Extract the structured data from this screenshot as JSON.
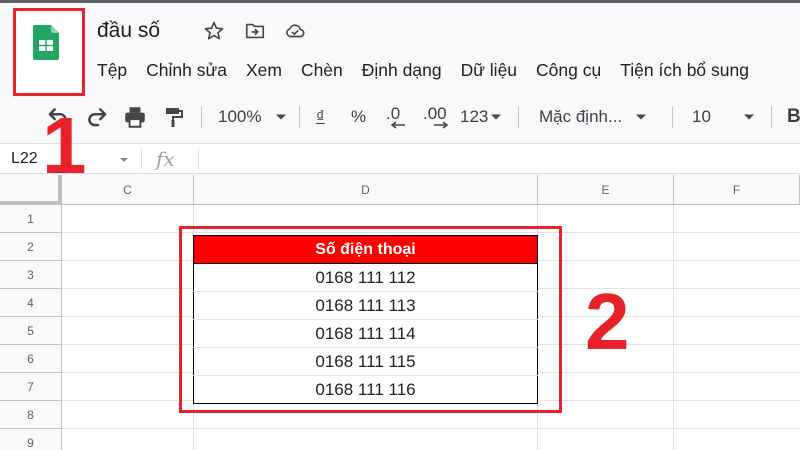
{
  "document": {
    "title": "đầu số"
  },
  "menu": [
    "Tệp",
    "Chỉnh sửa",
    "Xem",
    "Chèn",
    "Định dạng",
    "Dữ liệu",
    "Công cụ",
    "Tiện ích bổ sung"
  ],
  "toolbar": {
    "zoom": "100%",
    "currency": "₫",
    "percent": "%",
    "decrease_decimal": ".0",
    "increase_decimal": ".00",
    "more_formats": "123",
    "font": "Mặc định...",
    "font_size": "10",
    "bold": "B"
  },
  "formula_bar": {
    "cell_ref": "L22",
    "fx_label": "fx"
  },
  "columns": [
    "C",
    "D",
    "E",
    "F"
  ],
  "rows": [
    "1",
    "2",
    "3",
    "4",
    "5",
    "6",
    "7",
    "8",
    "9"
  ],
  "table": {
    "header": "Số điện thoại",
    "values": [
      "0168 111 112",
      "0168 111 113",
      "0168 111 114",
      "0168 111 115",
      "0168 111 116"
    ]
  },
  "annotations": {
    "callout_1": "1",
    "callout_2": "2"
  },
  "colors": {
    "highlight": "#e8212a",
    "header_fill": "#ff0000",
    "sheets_green": "#23a566"
  }
}
